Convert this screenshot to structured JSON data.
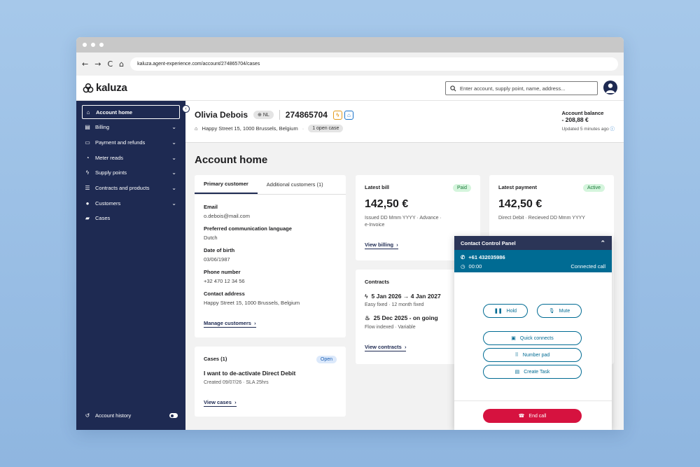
{
  "browser": {
    "url": "kaluza.agent-experience.com/account/274865704/cases",
    "nav_back": "←",
    "nav_forward": "→",
    "nav_reload": "C",
    "nav_home": "⌂"
  },
  "app": {
    "brand": "kaluza",
    "search_placeholder": "Enter account, supply point, name, address..."
  },
  "sidebar": {
    "items": [
      {
        "label": "Account home",
        "icon": "home-icon"
      },
      {
        "label": "Billing",
        "icon": "billing-icon"
      },
      {
        "label": "Payment and refunds",
        "icon": "card-icon"
      },
      {
        "label": "Meter reads",
        "icon": "meter-icon"
      },
      {
        "label": "Supply points",
        "icon": "bolt-icon"
      },
      {
        "label": "Contracts and products",
        "icon": "contract-icon"
      },
      {
        "label": "Customers",
        "icon": "person-icon"
      },
      {
        "label": "Cases",
        "icon": "folder-icon"
      }
    ],
    "footer_label": "Account history"
  },
  "account": {
    "name": "Olivia Debois",
    "country": "NL",
    "number": "274865704",
    "address": "Happy Street 15, 1000 Brussels, Belgium",
    "open_cases": "1 open case",
    "balance_title": "Account balance",
    "balance_value": "- 208,88 €",
    "balance_updated": "Updated 5 minutes ago"
  },
  "page_title": "Account home",
  "customer_card": {
    "tab_primary": "Primary customer",
    "tab_additional": "Additional customers (1)",
    "fields": [
      {
        "label": "Email",
        "value": "o.debois@mail.com"
      },
      {
        "label": "Preferred communication language",
        "value": "Dutch"
      },
      {
        "label": "Date of birth",
        "value": "03/06/1987"
      },
      {
        "label": "Phone number",
        "value": "+32 470 12 34 56"
      },
      {
        "label": "Contact address",
        "value": "Happy Street 15, 1000 Brussels, Belgium"
      }
    ],
    "link": "Manage customers"
  },
  "cases_card": {
    "title": "Cases (1)",
    "status": "Open",
    "case_title": "I want to de-activate Direct Debit",
    "meta": "Created 09/07/26  ·  SLA 25hrs",
    "link": "View cases"
  },
  "bill_card": {
    "title": "Latest bill",
    "status": "Paid",
    "amount": "142,50 €",
    "detail": "Issued DD Mmm YYYY  ·  Advance  ·",
    "detail2": "e-Invoice",
    "link": "View billing"
  },
  "payment_card": {
    "title": "Latest payment",
    "status": "Active",
    "amount": "142,50 €",
    "detail": "Direct Debit  ·  Recieved DD Mmm YYYY"
  },
  "contracts_card": {
    "title": "Contracts",
    "items": [
      {
        "icon": "bolt-icon",
        "dates": "5 Jan 2026 → 4 Jan 2027",
        "meta": "Easy fixed  ·  12 month fixed"
      },
      {
        "icon": "flame-icon",
        "dates": "25 Dec 2025 - on going",
        "meta": "Flow indexed  ·  Variable"
      }
    ],
    "link": "View contracts"
  },
  "ccp": {
    "title": "Contact Control Panel",
    "phone": "+61 432035986",
    "timer": "00:00",
    "call_status": "Connected call",
    "hold": "Hold",
    "mute": "Mute",
    "quick_connects": "Quick connects",
    "number_pad": "Number pad",
    "create_task": "Create Task",
    "end_call": "End call"
  },
  "colors": {
    "navy": "#1e2a52",
    "teal": "#006b93",
    "end_call_red": "#d6123f",
    "paid_green_bg": "#d5f5dd",
    "open_blue_bg": "#dce9fb"
  }
}
